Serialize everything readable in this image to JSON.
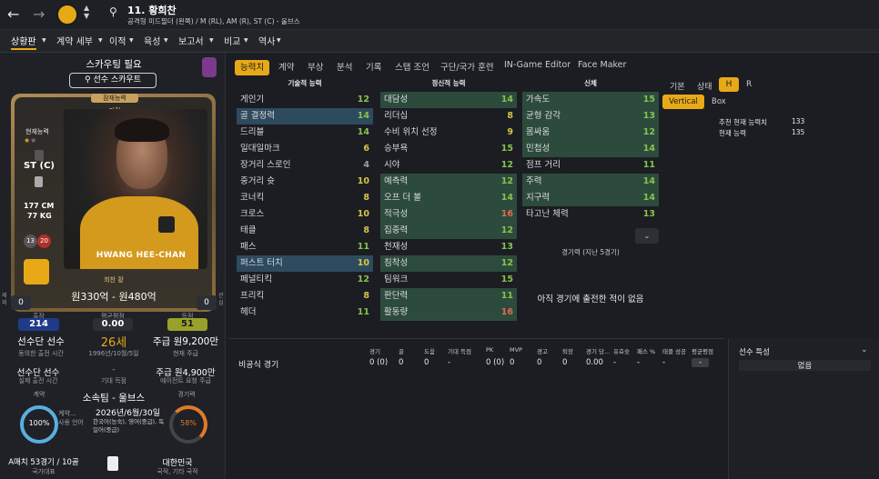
{
  "header": {
    "title": "11. 황희찬",
    "subtitle": "공격형 미드필더 (왼쪽) / M (RL), AM (R), ST (C) - 울브스"
  },
  "nav": [
    "상황판",
    "계약 세부",
    "이적",
    "육성",
    "보고서",
    "비교",
    "역사"
  ],
  "left": {
    "scout_needed": "스카우팅 필요",
    "scout_btn": "선수 스카우트",
    "potential": "잠재능력",
    "potential_val": "미정",
    "current_ability": "현재능력",
    "position": "ST (C)",
    "height": "177 CM",
    "weight": "77 KG",
    "badge1": "13",
    "badge2": "20",
    "name_card": "HWANG HEE-CHAN",
    "name_kr": "희찬 황",
    "value": "원330억 - 원480억",
    "left_num": "0",
    "right_num": "0",
    "left_side_label": "제외",
    "right_side_label": "관심",
    "apps_lbl": "출장",
    "apps": "214",
    "avg_lbl": "평균평점",
    "avg": "0.00",
    "goals_lbl": "득점",
    "goals": "51",
    "status": "선수단 선수",
    "status_sub": "동의한 출전 시간",
    "age": "26세",
    "dob": "1996년/10월/5일",
    "wage": "주급 원9,200만",
    "wage_sub": "현재 주급",
    "status2": "선수단 선수",
    "status2_sub": "실제 출전 시간",
    "expect_sub": "기대 득점",
    "wage2": "주급 원4,900만",
    "wage2_sub": "에이전트 요청 주급",
    "contract_lbl": "계약",
    "club": "소속팀 - 울브스",
    "contract_lbl2": "경기력",
    "pct1": "100%",
    "pct1_lbl": "계약...",
    "lang_lbl": "사용 언어",
    "contract_end": "2026년/6월/30일",
    "langs": "한국어(능숙), 영어(중급), 독일어(중급)",
    "pct2": "58%",
    "caps": "A매치 53경기 / 10골",
    "caps_sub": "국가대표",
    "nation": "대한민국",
    "nation_sub": "국적, 기타 국적"
  },
  "tabs": [
    "능력치",
    "계약",
    "부상",
    "분석",
    "기록",
    "스탭 조언",
    "구단/국가 훈련",
    "IN-Game Editor",
    "Face Maker"
  ],
  "cols": {
    "tech": "기술적 능력",
    "mental": "정신적 능력",
    "phys": "신체"
  },
  "tech": [
    [
      "게인기",
      "12",
      "g",
      ""
    ],
    [
      "골 결정력",
      "14",
      "g",
      "hl"
    ],
    [
      "드리블",
      "14",
      "g",
      ""
    ],
    [
      "일대일마크",
      "6",
      "y",
      ""
    ],
    [
      "장거리 스로인",
      "4",
      "gr",
      ""
    ],
    [
      "중거리 슛",
      "10",
      "y",
      ""
    ],
    [
      "코너킥",
      "8",
      "y",
      ""
    ],
    [
      "크로스",
      "10",
      "y",
      ""
    ],
    [
      "태클",
      "8",
      "y",
      ""
    ],
    [
      "패스",
      "11",
      "g",
      ""
    ],
    [
      "퍼스트 터치",
      "10",
      "y",
      "hl"
    ],
    [
      "페널티킥",
      "12",
      "g",
      ""
    ],
    [
      "프리킥",
      "8",
      "y",
      ""
    ],
    [
      "헤더",
      "11",
      "g",
      ""
    ]
  ],
  "mental": [
    [
      "대담성",
      "14",
      "g",
      "hlg"
    ],
    [
      "리더십",
      "8",
      "y",
      ""
    ],
    [
      "수비 위치 선정",
      "9",
      "y",
      ""
    ],
    [
      "승부욕",
      "15",
      "g",
      ""
    ],
    [
      "시야",
      "12",
      "g",
      ""
    ],
    [
      "예측력",
      "12",
      "g",
      "hlg"
    ],
    [
      "오프 더 볼",
      "14",
      "g",
      "hlg"
    ],
    [
      "적극성",
      "16",
      "rd",
      "hlg"
    ],
    [
      "집중력",
      "12",
      "g",
      "hlg"
    ],
    [
      "천재성",
      "13",
      "g",
      ""
    ],
    [
      "침착성",
      "12",
      "g",
      "hlg"
    ],
    [
      "팀워크",
      "15",
      "g",
      ""
    ],
    [
      "판단력",
      "11",
      "g",
      "hlg"
    ],
    [
      "활동량",
      "16",
      "rd",
      "hlg"
    ]
  ],
  "phys": [
    [
      "가속도",
      "15",
      "g",
      "hlg"
    ],
    [
      "균형 감각",
      "13",
      "g",
      "hlg"
    ],
    [
      "몸싸움",
      "12",
      "g",
      "hlg"
    ],
    [
      "민첩성",
      "14",
      "g",
      "hlg"
    ],
    [
      "점프 거리",
      "11",
      "g",
      ""
    ],
    [
      "주력",
      "14",
      "g",
      "hlg"
    ],
    [
      "지구력",
      "14",
      "g",
      "hlg"
    ],
    [
      "타고난 체력",
      "13",
      "g",
      ""
    ]
  ],
  "right": {
    "basic": "기본",
    "state": "상태",
    "h": "H",
    "r": "R",
    "vertical": "Vertical",
    "box": "Box",
    "rec_ca": "추천 현재 능력치",
    "rec_ca_val": "133",
    "ca": "현재 능력",
    "ca_val": "135"
  },
  "perf": {
    "title": "경기력 (지난 5경기)",
    "none": "아직 경기에 출전한 적이 없음"
  },
  "stats": {
    "headers": [
      "경기",
      "골",
      "도움",
      "기대 득점",
      "PK",
      "MVP",
      "경고",
      "퇴장",
      "경기 당...",
      "유효슛",
      "패스 %",
      "태클 성공",
      "평균평점"
    ],
    "row_label": "비공식 경기",
    "row": [
      "0 (0)",
      "0",
      "0",
      "-",
      "0 (0)",
      "0",
      "0",
      "0",
      "0.00",
      "-",
      "-",
      "-",
      "-"
    ]
  },
  "traits": {
    "title": "선수 특성",
    "none": "없음"
  }
}
